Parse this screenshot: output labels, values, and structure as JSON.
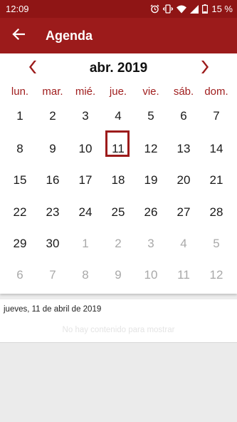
{
  "status_bar": {
    "time": "12:09",
    "battery": "15 %",
    "icons": [
      "alarm-icon",
      "vibrate-icon",
      "wifi-icon",
      "signal-icon",
      "battery-icon"
    ]
  },
  "app_bar": {
    "title": "Agenda",
    "back_icon": "arrow-left-icon"
  },
  "calendar": {
    "month_label": "abr. 2019",
    "prev_icon": "chevron-left-icon",
    "next_icon": "chevron-right-icon",
    "weekdays": [
      "lun.",
      "mar.",
      "mié.",
      "jue.",
      "vie.",
      "sáb.",
      "dom."
    ],
    "weeks": [
      [
        {
          "d": "1",
          "o": false
        },
        {
          "d": "2",
          "o": false
        },
        {
          "d": "3",
          "o": false
        },
        {
          "d": "4",
          "o": false
        },
        {
          "d": "5",
          "o": false
        },
        {
          "d": "6",
          "o": false
        },
        {
          "d": "7",
          "o": false
        }
      ],
      [
        {
          "d": "8",
          "o": false
        },
        {
          "d": "9",
          "o": false
        },
        {
          "d": "10",
          "o": false
        },
        {
          "d": "11",
          "o": false
        },
        {
          "d": "12",
          "o": false
        },
        {
          "d": "13",
          "o": false
        },
        {
          "d": "14",
          "o": false
        }
      ],
      [
        {
          "d": "15",
          "o": false
        },
        {
          "d": "16",
          "o": false
        },
        {
          "d": "17",
          "o": false
        },
        {
          "d": "18",
          "o": false
        },
        {
          "d": "19",
          "o": false
        },
        {
          "d": "20",
          "o": false
        },
        {
          "d": "21",
          "o": false
        }
      ],
      [
        {
          "d": "22",
          "o": false
        },
        {
          "d": "23",
          "o": false
        },
        {
          "d": "24",
          "o": false
        },
        {
          "d": "25",
          "o": false
        },
        {
          "d": "26",
          "o": false
        },
        {
          "d": "27",
          "o": false
        },
        {
          "d": "28",
          "o": false
        }
      ],
      [
        {
          "d": "29",
          "o": false
        },
        {
          "d": "30",
          "o": false
        },
        {
          "d": "1",
          "o": true
        },
        {
          "d": "2",
          "o": true
        },
        {
          "d": "3",
          "o": true
        },
        {
          "d": "4",
          "o": true
        },
        {
          "d": "5",
          "o": true
        }
      ],
      [
        {
          "d": "6",
          "o": true
        },
        {
          "d": "7",
          "o": true
        },
        {
          "d": "8",
          "o": true
        },
        {
          "d": "9",
          "o": true
        },
        {
          "d": "10",
          "o": true
        },
        {
          "d": "11",
          "o": true
        },
        {
          "d": "12",
          "o": true
        }
      ]
    ],
    "selected_day": "11"
  },
  "events": {
    "date_label": "jueves, 11 de abril de 2019",
    "empty_message": "No hay contenido para mostrar"
  },
  "colors": {
    "status_bar": "#8f1515",
    "app_bar": "#9c1b1b",
    "accent": "#a01e1e",
    "other_month_text": "#a9a9a9"
  }
}
